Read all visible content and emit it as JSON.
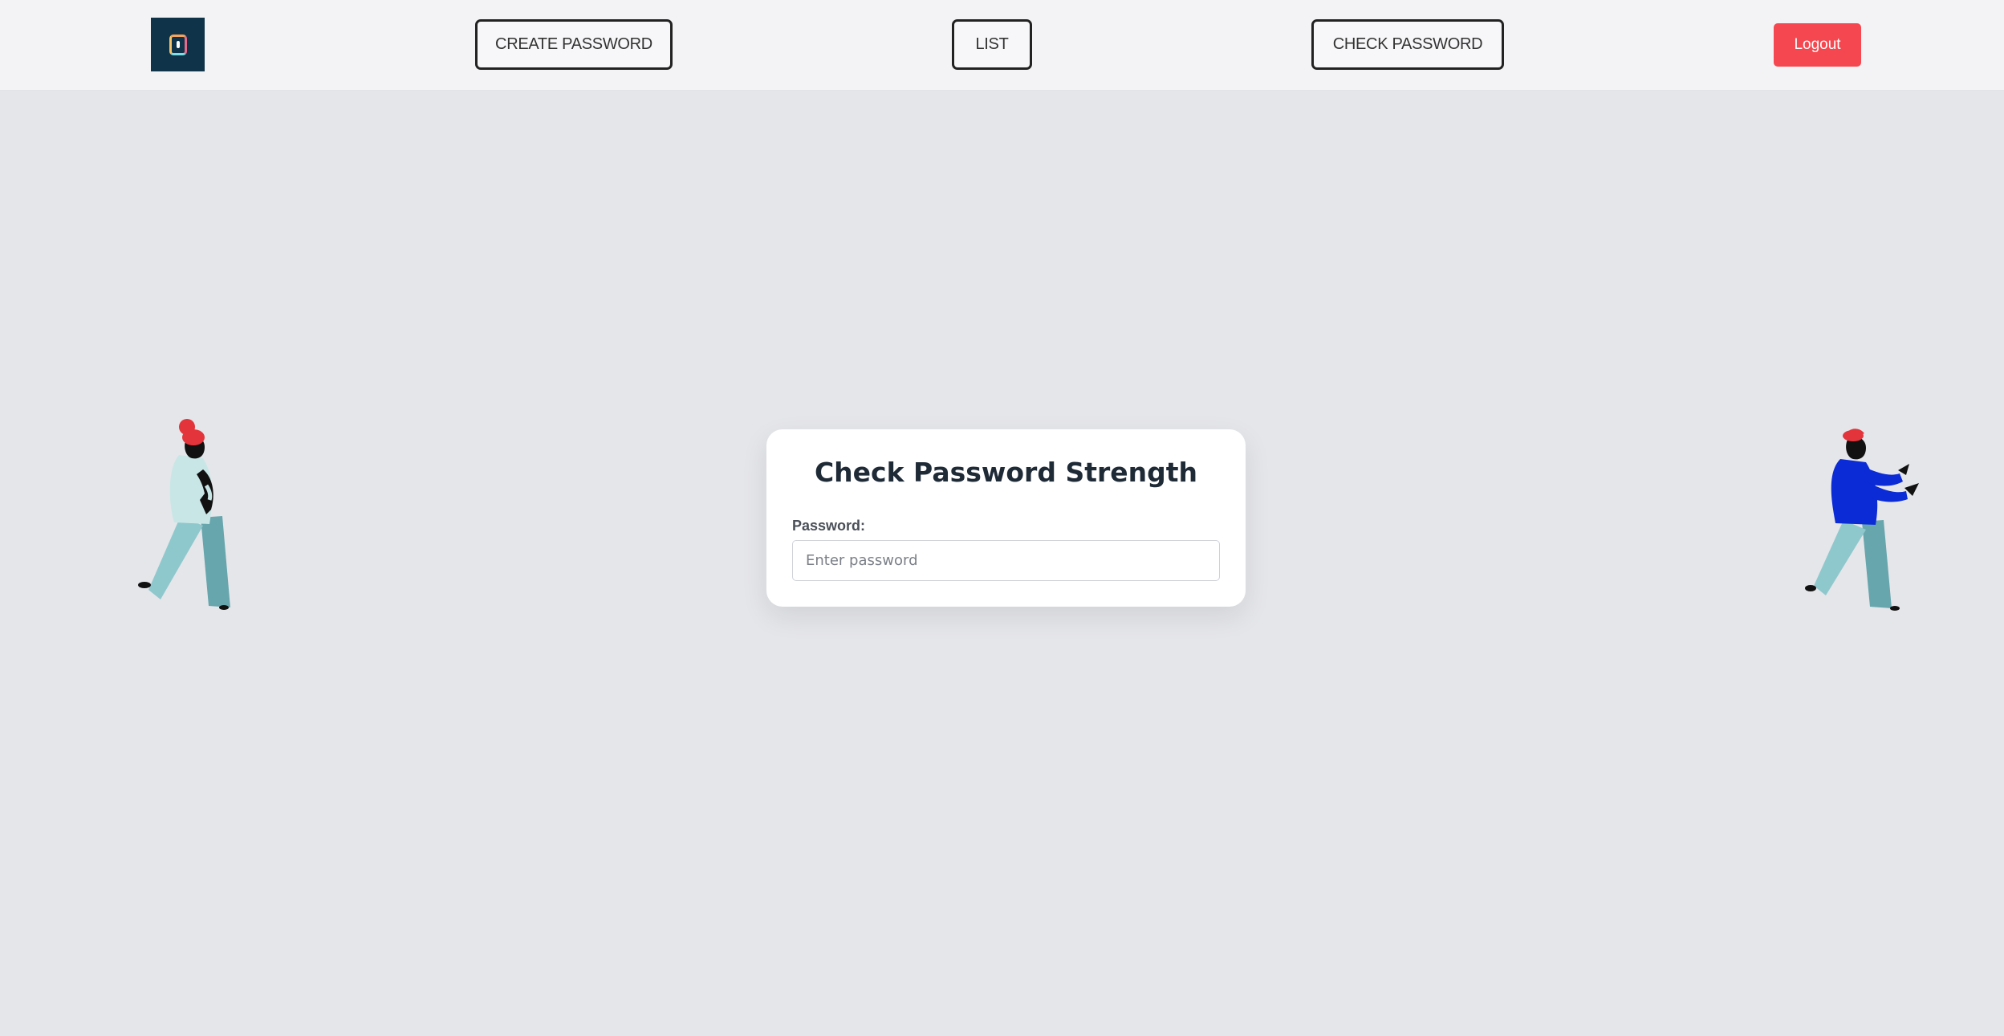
{
  "nav": {
    "logo_icon": "keyhole-lock-icon",
    "links": [
      {
        "label": "CREATE PASSWORD"
      },
      {
        "label": "LIST"
      },
      {
        "label": "CHECK PASSWORD"
      }
    ],
    "logout_label": "Logout"
  },
  "card": {
    "title": "Check Password Strength",
    "password_label": "Password:",
    "password_placeholder": "Enter password",
    "password_value": ""
  },
  "colors": {
    "logout": "#f5474f",
    "logo_bg": "#0f3349",
    "background": "#e5e6ea",
    "navbar": "#f3f3f5"
  }
}
